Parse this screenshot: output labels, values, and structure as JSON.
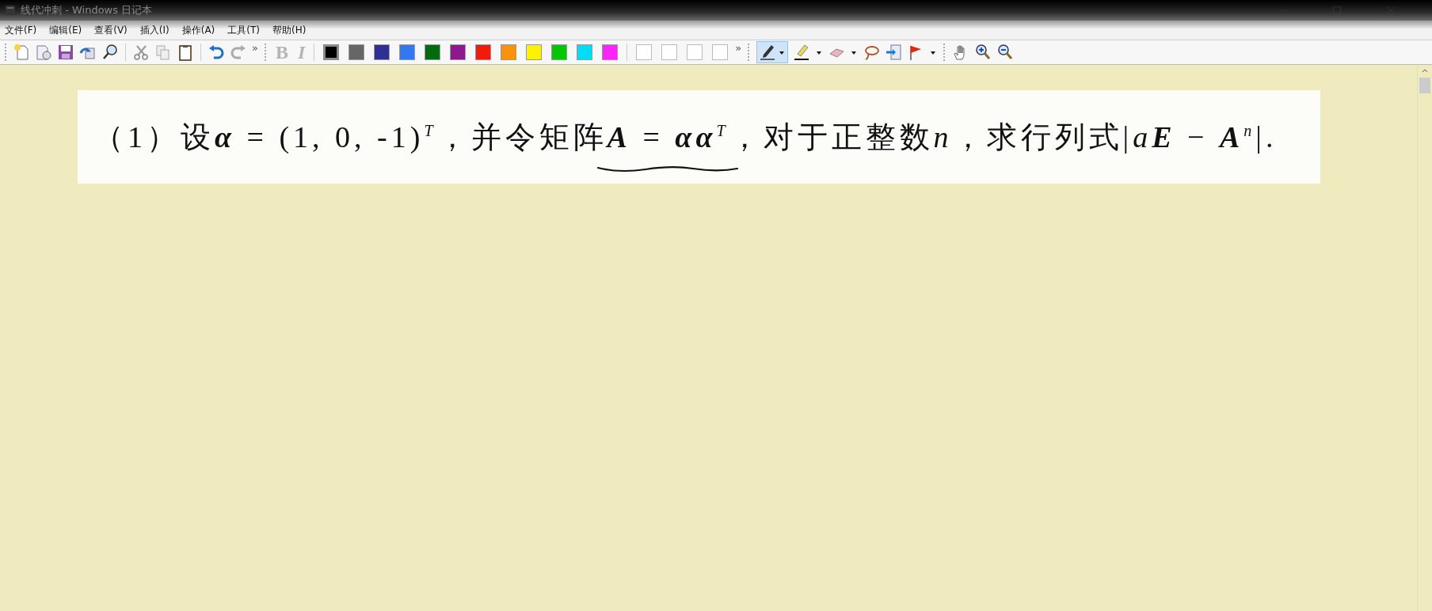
{
  "window": {
    "title": "线代冲刺 - Windows 日记本"
  },
  "menu": [
    {
      "label": "文件(F)"
    },
    {
      "label": "编辑(E)"
    },
    {
      "label": "查看(V)"
    },
    {
      "label": "插入(I)"
    },
    {
      "label": "操作(A)"
    },
    {
      "label": "工具(T)"
    },
    {
      "label": "帮助(H)"
    }
  ],
  "toolbar": {
    "overflow_marks": [
      "»",
      "»"
    ],
    "format_buttons": [
      {
        "label": "B",
        "kind": "bold",
        "disabled": true
      },
      {
        "label": "I",
        "kind": "italic",
        "disabled": true
      }
    ],
    "colors": [
      {
        "color": "#000000",
        "selected": true
      },
      {
        "color": "#666666",
        "selected": false
      },
      {
        "color": "#2e3192",
        "selected": false
      },
      {
        "color": "#3476f5",
        "selected": false
      },
      {
        "color": "#006a0e",
        "selected": false
      },
      {
        "color": "#8b1a8c",
        "selected": false
      },
      {
        "color": "#f21a0e",
        "selected": false
      },
      {
        "color": "#ff9108",
        "selected": false
      },
      {
        "color": "#fff200",
        "selected": false
      },
      {
        "color": "#00c800",
        "selected": false
      },
      {
        "color": "#00dcf0",
        "selected": false
      },
      {
        "color": "#ff24ff",
        "selected": false
      },
      {
        "color": "#ffffff",
        "selected": false
      },
      {
        "color": "#ffffff",
        "selected": false
      },
      {
        "color": "#ffffff",
        "selected": false
      },
      {
        "color": "#ffffff",
        "selected": false
      }
    ],
    "pen_tool": {
      "selected": true
    }
  },
  "page": {
    "question": [
      {
        "text": "（1）设",
        "kind": "plain"
      },
      {
        "text": "α",
        "kind": "bold"
      },
      {
        "text": " = (1, 0, -1)",
        "kind": "plain"
      },
      {
        "text": "T",
        "kind": "sup"
      },
      {
        "text": "，并令矩阵",
        "kind": "plain"
      },
      {
        "text": "A",
        "kind": "bold"
      },
      {
        "text": " = ",
        "kind": "plain"
      },
      {
        "text": "αα",
        "kind": "bold"
      },
      {
        "text": "T",
        "kind": "sup"
      },
      {
        "text": "，对于正整数",
        "kind": "plain"
      },
      {
        "text": "n",
        "kind": "italic"
      },
      {
        "text": "，求行列式|",
        "kind": "plain"
      },
      {
        "text": "a",
        "kind": "italic"
      },
      {
        "text": "E",
        "kind": "bold"
      },
      {
        "text": " − ",
        "kind": "plain"
      },
      {
        "text": "A",
        "kind": "bold"
      },
      {
        "text": "n",
        "kind": "sup"
      },
      {
        "text": "|.",
        "kind": "plain"
      }
    ]
  }
}
